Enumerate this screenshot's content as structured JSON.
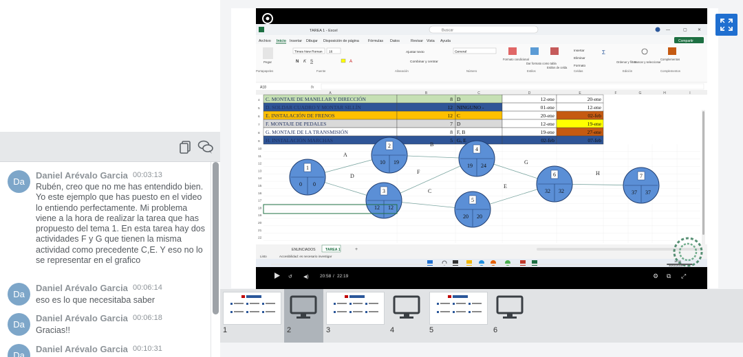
{
  "chat": {
    "messages": [
      {
        "initials": "Da",
        "author": "Daniel Arévalo Garcia",
        "time": "00:03:13",
        "text": "Rubén, creo que no me has entendido bien. Yo este ejemplo que has puesto en el video lo entiendo perfectamente. Mi problema viene a la hora de realizar la tarea que has propuesto del tema 1. En esta tarea hay dos actividades F y G que tienen la misma actividad como precedente C,E. Y eso no lo se representar en el grafico"
      },
      {
        "initials": "Da",
        "author": "Daniel Arévalo Garcia",
        "time": "00:06:14",
        "text": "eso es lo que necesitaba saber"
      },
      {
        "initials": "Da",
        "author": "Daniel Arévalo Garcia",
        "time": "00:06:18",
        "text": "Gracias!!"
      },
      {
        "initials": "Da",
        "author": "Daniel Arévalo Garcia",
        "time": "00:10:31",
        "text": ""
      }
    ]
  },
  "excel": {
    "file_title": "TAREA 1 - Excel",
    "search": "Buscar",
    "menu": [
      "Archivo",
      "Inicio",
      "Insertar",
      "Dibujar",
      "Disposición de página",
      "Fórmulas",
      "Datos",
      "Revisar",
      "Vista",
      "Ayuda"
    ],
    "share": "Compartir",
    "groups": [
      "Portapapeles",
      "Fuente",
      "Alineación",
      "Número",
      "Estilos",
      "Celdas",
      "Edición",
      "Complementos"
    ],
    "font_name": "Times New Roman",
    "font_size": "16",
    "number_format": "General",
    "wrap_text": "Ajustar texto",
    "merge": "Combinar y centrar",
    "cond_format": "Formato condicional",
    "table_format": "Dar formato como tabla",
    "cell_styles": "Estilos de celda",
    "insert": "Insertar",
    "delete": "Eliminar",
    "format": "Formato",
    "sort": "Ordenar y filtrar",
    "find": "Buscar y seleccionar",
    "addins": "Complementos",
    "paste": "Pegar",
    "cell_ref": "A18",
    "col_headers": [
      "A",
      "B",
      "C",
      "D",
      "E",
      "F",
      "G",
      "H",
      "I"
    ],
    "rows": [
      {
        "n": "4",
        "a": "C. MONTAJE DE MANILLAR Y DIRECCIÓN",
        "b": "8",
        "c": "D",
        "d": "12-ene",
        "e": "20-ene"
      },
      {
        "n": "5",
        "a": "D. SOLDAR CUADRO Y MONTAR SILLÍN",
        "b": "12",
        "c": "NINGUNO -",
        "d": "01-ene",
        "e": "12-ene"
      },
      {
        "n": "6",
        "a": "E. INSTALACIÓN DE FRENOS",
        "b": "12",
        "c": "C",
        "d": "20-ene",
        "e": "02-feb"
      },
      {
        "n": "7",
        "a": "F. MONTAJE DE PEDALES",
        "b": "7",
        "c": "D",
        "d": "12-ene",
        "e": "19-ene"
      },
      {
        "n": "8",
        "a": "G. MONTAJE DE LA TRANSMISIÓN",
        "b": "8",
        "c": "F, B",
        "d": "19-ene",
        "e": "27-ene"
      },
      {
        "n": "9",
        "a": "H. INSTALACIÓN MARCHAS",
        "b": "5",
        "c": "G, E",
        "d": "02-feb",
        "e": "07-feb"
      }
    ],
    "more_rows": [
      "10",
      "11",
      "12",
      "13",
      "14",
      "15",
      "16",
      "17",
      "18",
      "19",
      "20",
      "21",
      "22"
    ],
    "nodes": [
      {
        "id": "1",
        "l": "0",
        "r": "0"
      },
      {
        "id": "2",
        "l": "10",
        "r": "19"
      },
      {
        "id": "3",
        "l": "12",
        "r": "12"
      },
      {
        "id": "4",
        "l": "19",
        "r": "24"
      },
      {
        "id": "5",
        "l": "20",
        "r": "20"
      },
      {
        "id": "6",
        "l": "32",
        "r": "32"
      },
      {
        "id": "7",
        "l": "37",
        "r": "37"
      }
    ],
    "edges": [
      "A",
      "B",
      "C",
      "D",
      "E",
      "F",
      "G",
      "H"
    ],
    "sheets": [
      "ENUNCIADOS",
      "TAREA 1"
    ],
    "status_left": "Listo",
    "accessibility": "Accesibilidad: es necesario investigar",
    "clock_time": "16:35",
    "clock_date": "30/01/2025"
  },
  "player": {
    "current": "20:58",
    "total": "22:19",
    "separator": "/",
    "progress": 0.94
  },
  "thumbnails": [
    {
      "num": "1",
      "type": "slide"
    },
    {
      "num": "2",
      "type": "monitor",
      "selected": true
    },
    {
      "num": "3",
      "type": "slide"
    },
    {
      "num": "4",
      "type": "monitor"
    },
    {
      "num": "5",
      "type": "slide"
    },
    {
      "num": "6",
      "type": "monitor"
    }
  ],
  "colors": {
    "accent": "#1f6fd0",
    "avatar": "#7da6c9",
    "node": "#5b8fd6",
    "green": "#c6e0b4",
    "blue": "#2f5597",
    "orange": "#ffc000",
    "yellow": "#ffff00",
    "brown": "#c55a11"
  }
}
